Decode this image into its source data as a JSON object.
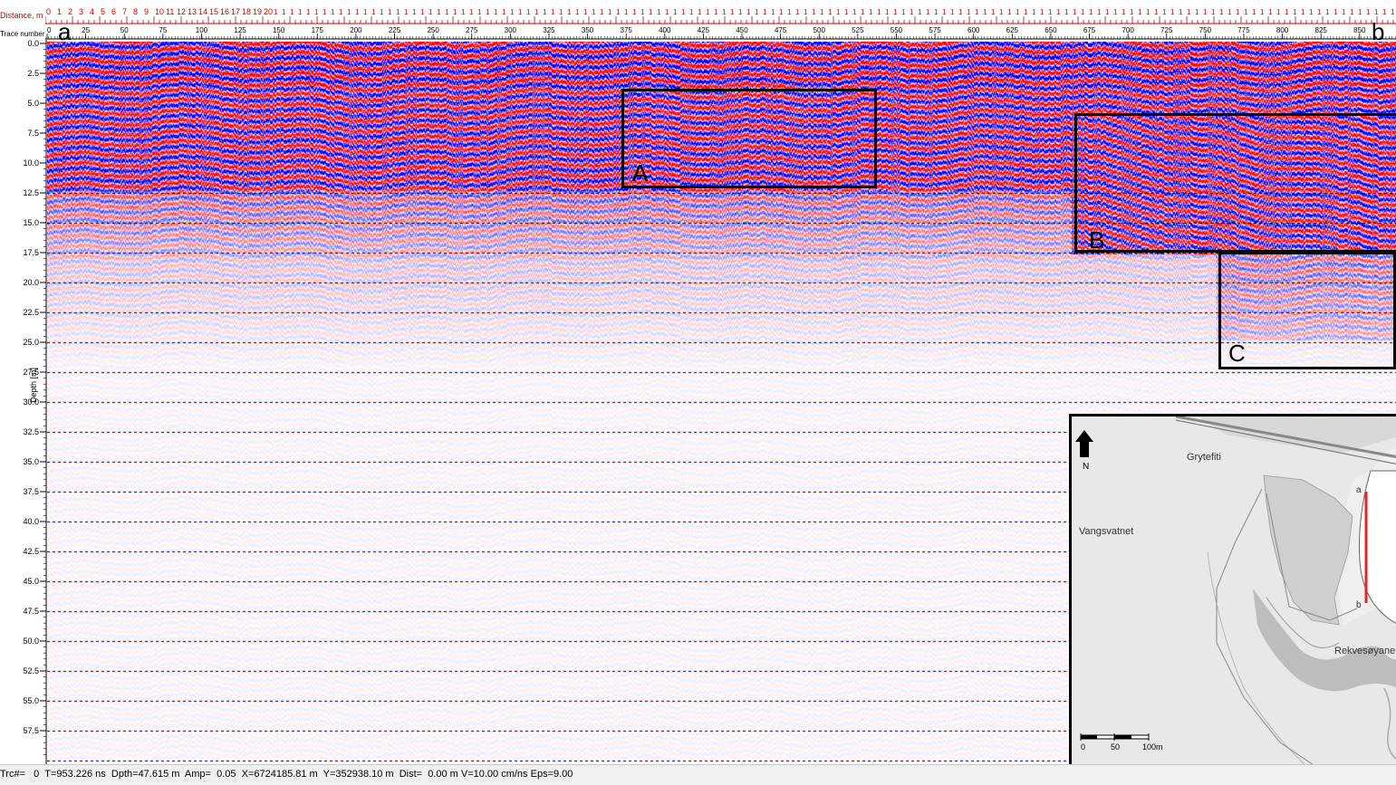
{
  "rulers": {
    "distance_label": "Distance, m",
    "trace_label": "Trace number",
    "distance_ticks": [
      "0",
      "1",
      "2",
      "3",
      "4",
      "5",
      "6",
      "7",
      "8",
      "9",
      "10",
      "11",
      "12",
      "13",
      "14",
      "15",
      "16",
      "17",
      "18",
      "19",
      "20"
    ],
    "trace_ticks": [
      "0",
      "25",
      "50",
      "75",
      "100",
      "125",
      "150",
      "175",
      "200",
      "225",
      "250",
      "275",
      "300",
      "325",
      "350",
      "375",
      "400",
      "425",
      "450",
      "475",
      "500",
      "525",
      "550",
      "575",
      "600",
      "625",
      "650",
      "675",
      "700",
      "725",
      "750",
      "775",
      "800",
      "825",
      "850"
    ],
    "depth_ticks": [
      "0.0",
      "2.5",
      "5.0",
      "7.5",
      "10.0",
      "12.5",
      "15.0",
      "17.5",
      "20.0",
      "22.5",
      "25.0",
      "27.5",
      "30.0",
      "32.5",
      "35.0",
      "37.5",
      "40.0",
      "42.5",
      "45.0",
      "47.5",
      "50.0",
      "52.5",
      "55.0",
      "57.5"
    ],
    "depth_axis_title": "Depth [m]"
  },
  "profile": {
    "start_label": "a",
    "end_label": "b",
    "colors": {
      "positive": "#ff0000",
      "negative": "#0000ff",
      "background": "#ffffff"
    }
  },
  "annotations": [
    {
      "label": "A"
    },
    {
      "label": "B"
    },
    {
      "label": "C"
    }
  ],
  "inset_map": {
    "north_label": "N",
    "places": {
      "grytefiti": "Grytefiti",
      "vangsvatnet": "Vangsvatnet",
      "rekvesoyane": "Rekvesøyane"
    },
    "profile_start": "a",
    "profile_end": "b",
    "scale_labels": [
      "0",
      "50",
      "100m"
    ]
  },
  "status": {
    "trace": "0",
    "time": "953.226 ns",
    "depth": "47.615 m",
    "amp": "0.05",
    "x": "6724185.81 m",
    "y": "352938.10 m",
    "dist": "0.00 m",
    "velocity": "10.00 cm/ns",
    "eps": "9.00",
    "text": "Trc#=   0  T=953.226 ns  Dpth=47.615 m  Amp=  0.05  X=6724185.81 m  Y=352938.10 m  Dist=  0.00 m V=10.00 cm/ns Eps=9.00"
  }
}
